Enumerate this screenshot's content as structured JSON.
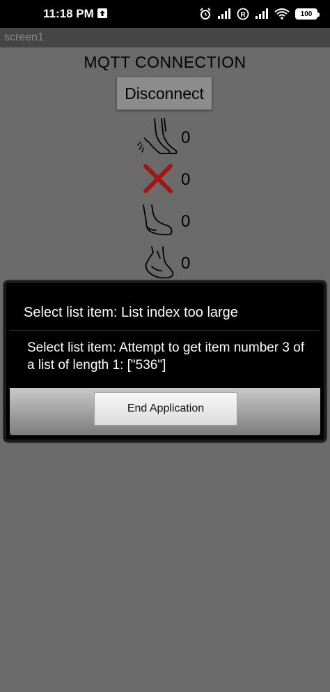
{
  "status_bar": {
    "time": "11:18 PM",
    "icons": [
      "upload-icon",
      "alarm-icon",
      "signal-icon",
      "roaming-r-icon",
      "signal-icon",
      "wifi-icon",
      "battery-icon"
    ],
    "battery": "100"
  },
  "title_bar": {
    "title": "screen1"
  },
  "main": {
    "connection_label": "MQTT CONNECTION",
    "disconnect_label": "Disconnect",
    "rows": [
      {
        "icon": "heel-lift-feet-icon",
        "value": "0"
      },
      {
        "icon": "red-x-icon",
        "value": "0",
        "color": "#a31515"
      },
      {
        "icon": "foot-flat-icon",
        "value": "0"
      },
      {
        "icon": "foot-arch-icon",
        "value": "0"
      }
    ]
  },
  "dialog": {
    "title": "Select list item: List index too large",
    "message": "Select list item: Attempt to get item number 3 of a list of length 1: [\"536\"]",
    "button_label": "End Application"
  }
}
